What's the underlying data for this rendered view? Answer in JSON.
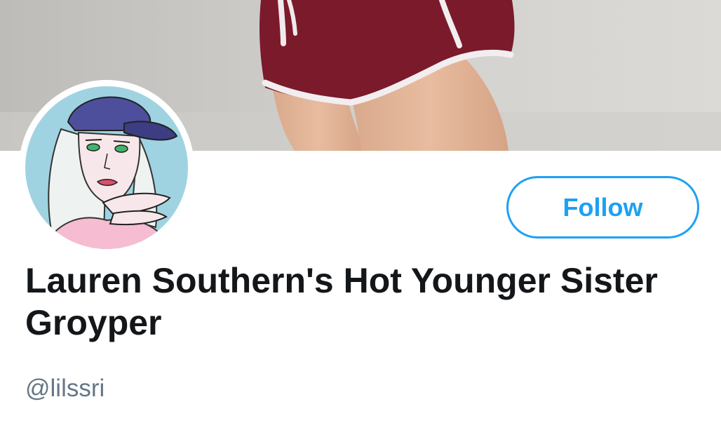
{
  "profile": {
    "display_name": "Lauren Southern's Hot Younger Sister Groyper",
    "handle": "@lilssri",
    "follow_label": "Follow"
  },
  "colors": {
    "accent": "#1da1f2",
    "name_text": "#14171a",
    "handle_text": "#657786",
    "shorts": "#7b1a2b"
  },
  "icons": {
    "avatar": "cartoon-girl-cap-avatar",
    "banner": "banner-photo"
  }
}
